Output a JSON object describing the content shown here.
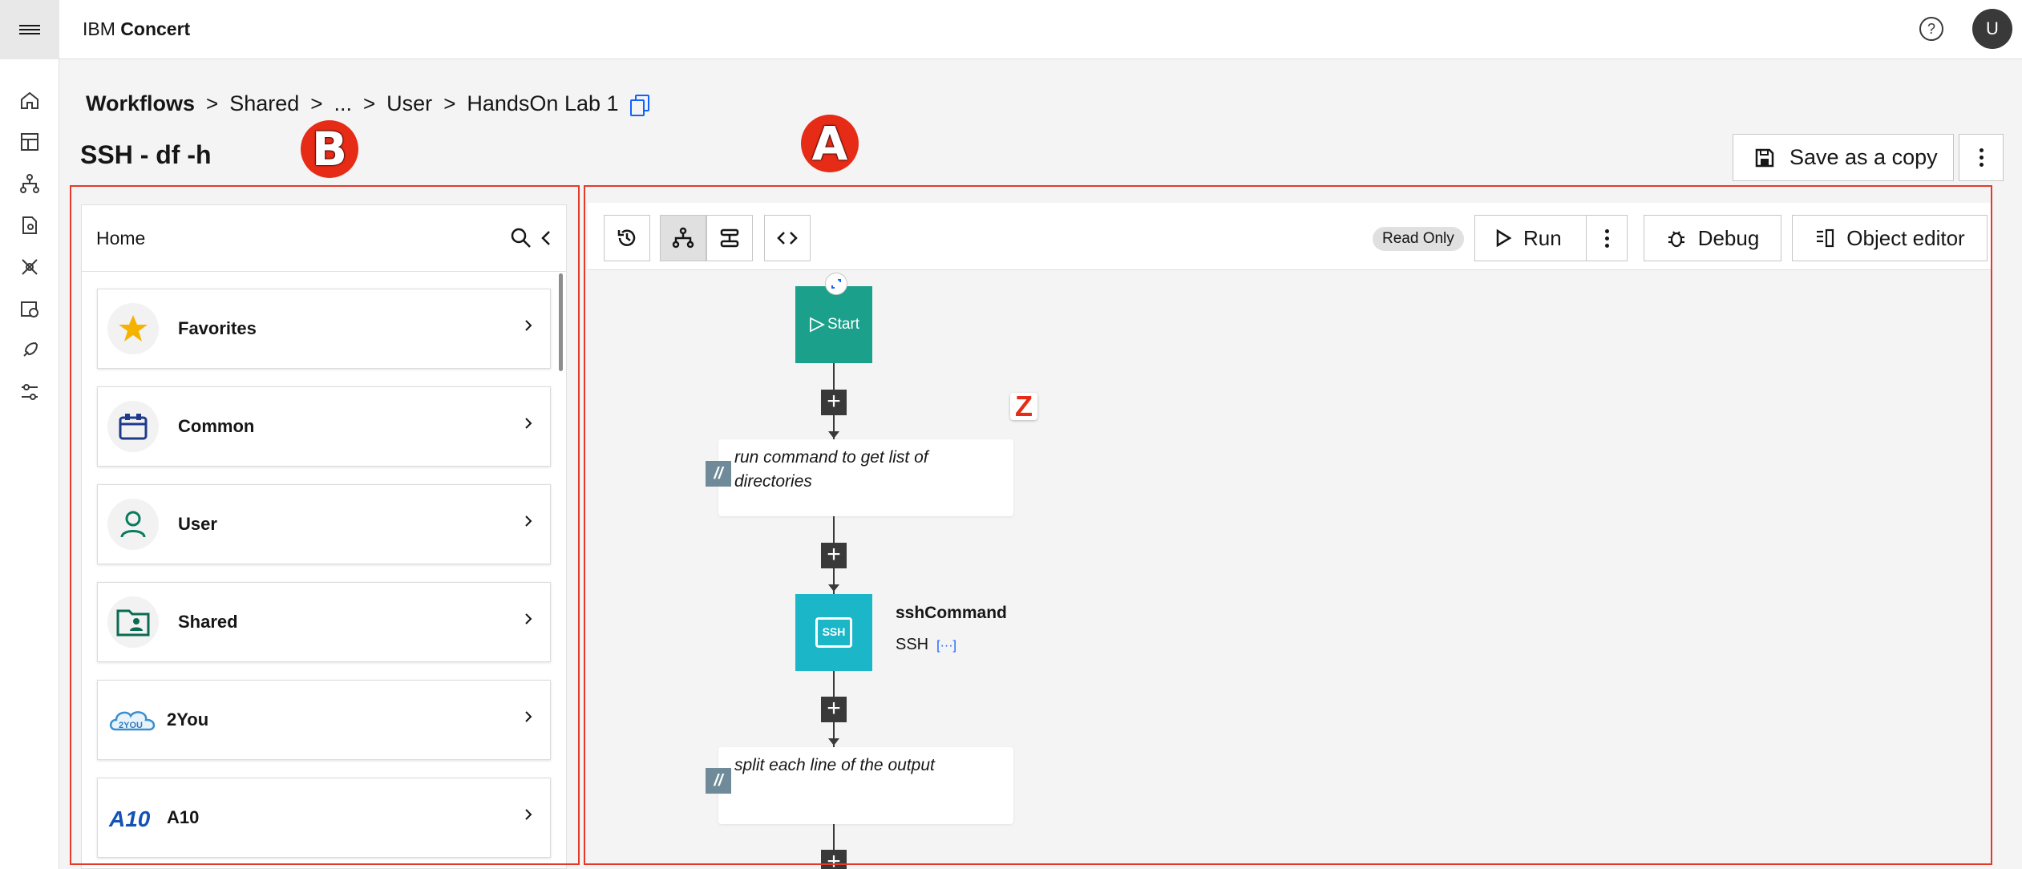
{
  "header": {
    "brand_prefix": "IBM",
    "brand_name": "Concert",
    "help_label": "?",
    "avatar_initial": "U"
  },
  "breadcrumb": {
    "items": [
      "Workflows",
      "Shared",
      "...",
      "User",
      "HandsOn Lab 1"
    ],
    "separator": ">"
  },
  "page": {
    "title": "SSH - df -h",
    "save_copy_label": "Save as a copy"
  },
  "annotations": {
    "panel_a": "A",
    "panel_b": "B",
    "marker_z": "Z"
  },
  "palette": {
    "header": "Home",
    "items": [
      {
        "label": "Favorites",
        "icon": "star-icon"
      },
      {
        "label": "Common",
        "icon": "calendar-box-icon"
      },
      {
        "label": "User",
        "icon": "user-icon"
      },
      {
        "label": "Shared",
        "icon": "shared-folder-icon"
      },
      {
        "label": "2You",
        "icon": "2you-cloud-logo"
      },
      {
        "label": "A10",
        "icon": "a10-logo"
      }
    ]
  },
  "toolbar": {
    "read_only": "Read Only",
    "run_label": "Run",
    "debug_label": "Debug",
    "object_editor_label": "Object editor"
  },
  "flow": {
    "start_label": "Start",
    "comment1": "run command to get list of directories",
    "comment_tag": "//",
    "ssh_node_title": "sshCommand",
    "ssh_node_sub": "SSH",
    "ssh_node_more": "[···]",
    "ssh_glyph": "SSH",
    "comment2": "split each line of the output"
  },
  "colors": {
    "accent_red": "#e62b16",
    "start_node": "#1ba08b",
    "ssh_node": "#1bb7c8",
    "link_blue": "#0f62fe"
  }
}
